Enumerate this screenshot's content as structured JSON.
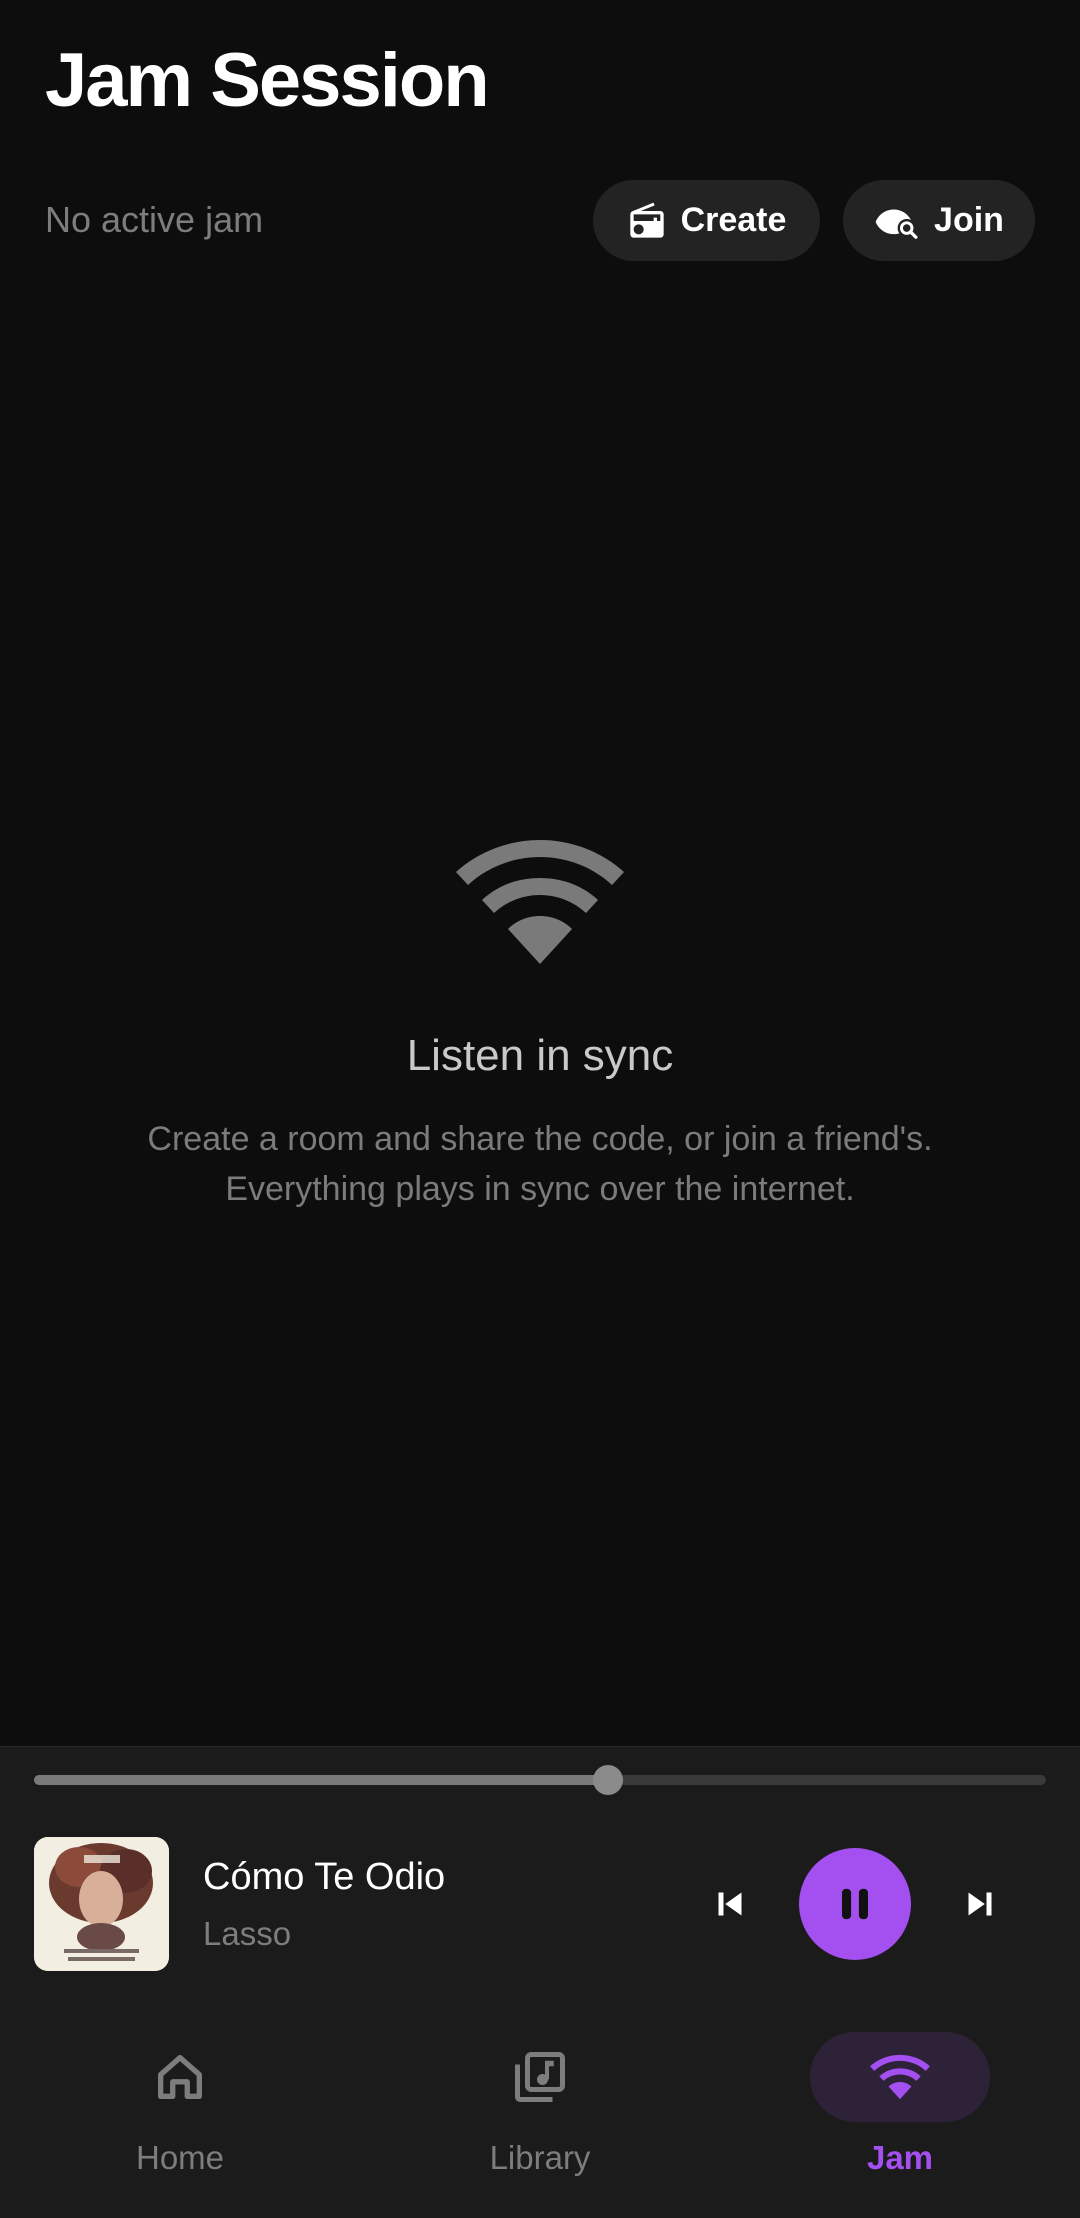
{
  "header": {
    "title": "Jam Session",
    "status": "No active jam",
    "create_label": "Create",
    "join_label": "Join"
  },
  "empty_state": {
    "icon": "wifi-icon",
    "title": "Listen in sync",
    "desc_line1": "Create a room and share the code, or join a friend's.",
    "desc_line2": "Everything plays in sync over the internet."
  },
  "player": {
    "track_title": "Cómo Te Odio",
    "artist": "Lasso",
    "progress": 0.567,
    "is_playing": true,
    "accent_color": "#a44ff0"
  },
  "nav": {
    "items": [
      {
        "label": "Home",
        "icon": "home-icon",
        "active": false
      },
      {
        "label": "Library",
        "icon": "library-music-icon",
        "active": false
      },
      {
        "label": "Jam",
        "icon": "wifi-icon",
        "active": true
      }
    ]
  }
}
